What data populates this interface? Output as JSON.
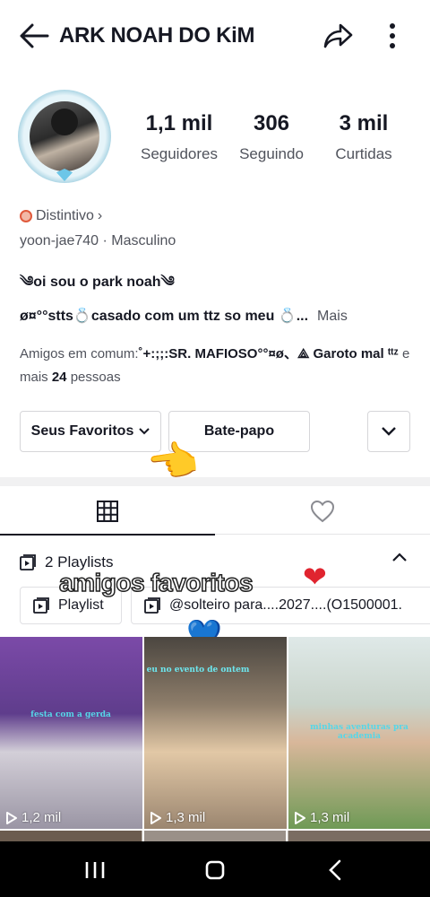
{
  "header": {
    "title": "ARK NOAH DO KiM",
    "back_icon": "arrow-left-icon",
    "share_icon": "share-arrow-icon",
    "more_icon": "vertical-dots-icon"
  },
  "profile": {
    "stats": [
      {
        "value": "1,1 mil",
        "label": "Seguidores"
      },
      {
        "value": "306",
        "label": "Seguindo"
      },
      {
        "value": "3 mil",
        "label": "Curtidas"
      }
    ],
    "badge_label": "Distintivo",
    "badge_chevron": "›",
    "meta": "yoon-jae740 · Masculino",
    "bio_line_1": "༄oi sou o park noah༄",
    "bio_line_2": "ø¤°°stts💍casado com um ttz so meu 💍...",
    "bio_more": "Mais",
    "friends": {
      "prefix": "Amigos em comum:",
      "names": "˚+:;;:SR. MAFIOSO°°¤ø、⟁ Garoto mal ᵗᵗᶻ",
      "middle": "e mais",
      "count": "24",
      "suffix": "pessoas"
    }
  },
  "actions": {
    "favorites_label": "Seus Favoritos",
    "chat_label": "Bate-papo",
    "pointer_emoji": "👈"
  },
  "tabs": {
    "grid_icon": "grid-icon",
    "liked_icon": "heart-outline-icon"
  },
  "playlists": {
    "header": "2 Playlists",
    "chips": [
      "Playlist",
      "@solteiro para....2027....(O1500001."
    ]
  },
  "overlay": {
    "text": "amigos favoritos",
    "heart_red": "❤",
    "heart_blue": "💙"
  },
  "videos": [
    {
      "caption": "festa com a gerda",
      "views": "1,2 mil"
    },
    {
      "caption": "eu no evento de ontem",
      "views": "1,3 mil"
    },
    {
      "caption": "minhas aventuras pra academia",
      "views": "1,3 mil"
    }
  ],
  "colors": {
    "text": "#161823",
    "secondary": "#50535c",
    "heart_red": "#e0242f",
    "heart_blue": "#3aa6e6"
  }
}
